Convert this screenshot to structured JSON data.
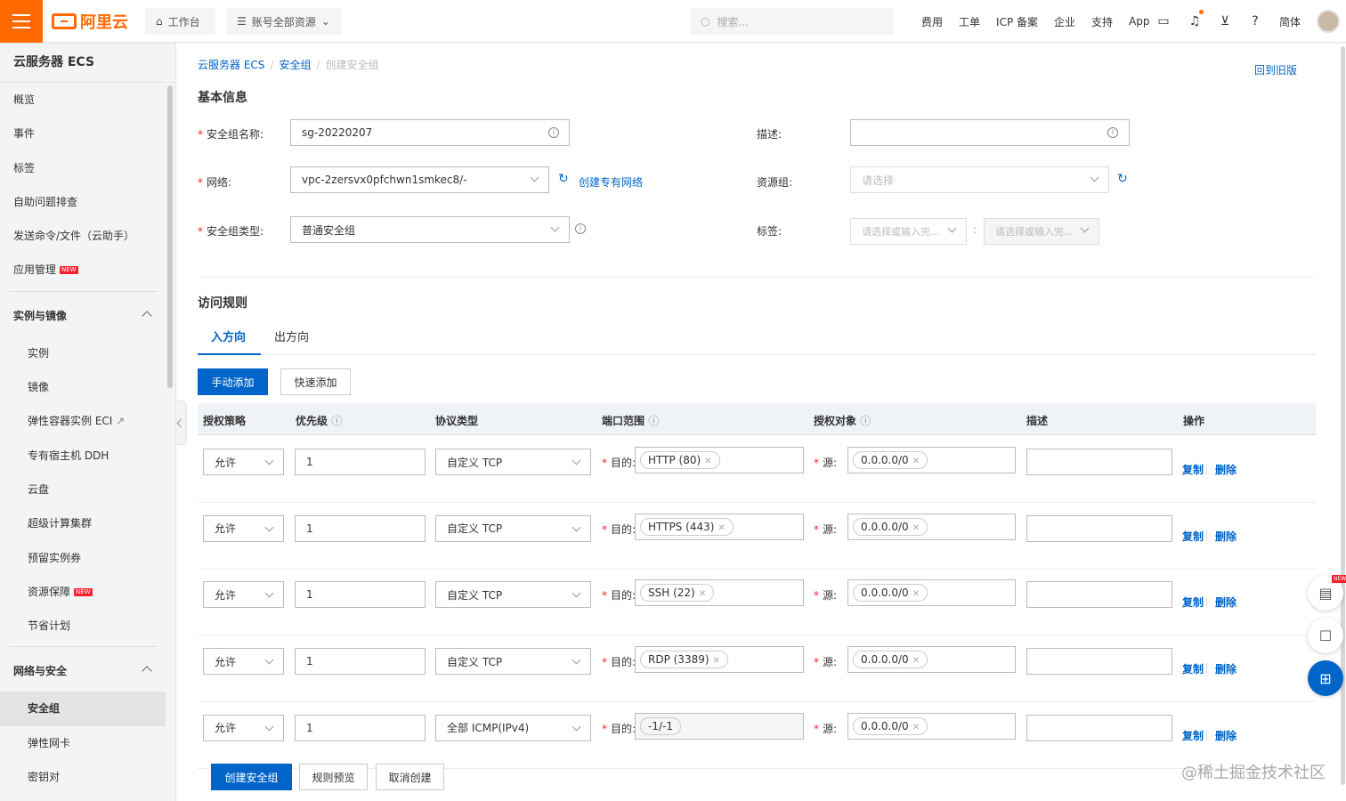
{
  "topbar": {
    "logo_text": "阿里云",
    "workbench": "工作台",
    "resources": "账号全部资源",
    "search_placeholder": "搜索...",
    "nav": [
      "费用",
      "工单",
      "ICP 备案",
      "企业",
      "支持",
      "App"
    ],
    "lang": "简体"
  },
  "sidebar": {
    "title": "云服务器 ECS",
    "top_items": [
      "概览",
      "事件",
      "标签",
      "自助问题排查",
      "发送命令/文件（云助手）",
      "应用管理"
    ],
    "group1": "实例与镜像",
    "group1_items": [
      "实例",
      "镜像",
      "弹性容器实例 ECI",
      "专有宿主机 DDH",
      "云盘",
      "超级计算集群",
      "预留实例券",
      "资源保障",
      "节省计划"
    ],
    "group2": "网络与安全",
    "group2_items": [
      "安全组",
      "弹性网卡",
      "密钥对"
    ],
    "new_badge": "NEW"
  },
  "breadcrumb": {
    "b1": "云服务器 ECS",
    "b2": "安全组",
    "b3": "创建安全组"
  },
  "back_link": "回到旧版",
  "basic": {
    "heading": "基本信息",
    "name_label": "安全组名称:",
    "name_value": "sg-20220207",
    "network_label": "网络:",
    "network_value": "vpc-2zersvx0pfchwn1smkec8/-",
    "create_vpc": "创建专有网络",
    "type_label": "安全组类型:",
    "type_value": "普通安全组",
    "desc_label": "描述:",
    "rg_label": "资源组:",
    "rg_placeholder": "请选择",
    "tag_label": "标签:",
    "tag_key_placeholder": "请选择或输入完...",
    "tag_val_placeholder": "请选择或输入完..."
  },
  "rules": {
    "heading": "访问规则",
    "tab_in": "入方向",
    "tab_out": "出方向",
    "btn_manual": "手动添加",
    "btn_quick": "快速添加",
    "headers": {
      "policy": "授权策略",
      "priority": "优先级",
      "protocol": "协议类型",
      "port": "端口范围",
      "object": "授权对象",
      "desc": "描述",
      "action": "操作"
    },
    "dest_label": "目的:",
    "src_label": "源:",
    "copy": "复制",
    "delete": "删除",
    "rows": [
      {
        "policy": "允许",
        "priority": "1",
        "protocol": "自定义 TCP",
        "port": "HTTP (80)",
        "source": "0.0.0.0/0"
      },
      {
        "policy": "允许",
        "priority": "1",
        "protocol": "自定义 TCP",
        "port": "HTTPS (443)",
        "source": "0.0.0.0/0"
      },
      {
        "policy": "允许",
        "priority": "1",
        "protocol": "自定义 TCP",
        "port": "SSH (22)",
        "source": "0.0.0.0/0"
      },
      {
        "policy": "允许",
        "priority": "1",
        "protocol": "自定义 TCP",
        "port": "RDP (3389)",
        "source": "0.0.0.0/0"
      },
      {
        "policy": "允许",
        "priority": "1",
        "protocol": "全部 ICMP(IPv4)",
        "port": "-1/-1",
        "source": "0.0.0.0/0"
      }
    ]
  },
  "footer": {
    "create": "创建安全组",
    "preview": "规则预览",
    "cancel": "取消创建"
  },
  "watermark": "@稀土掘金技术社区"
}
